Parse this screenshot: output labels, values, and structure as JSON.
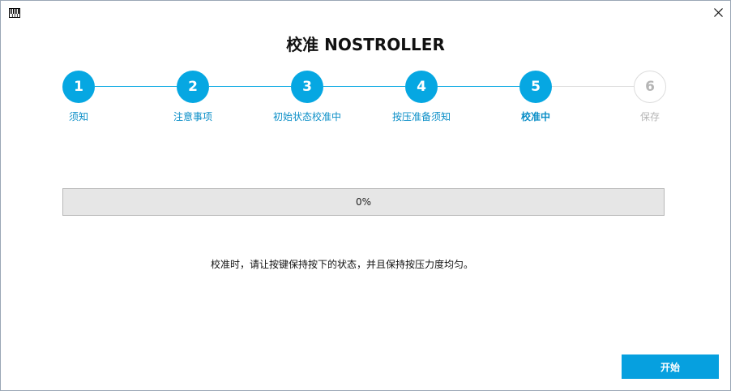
{
  "window": {
    "title": "校准 NOSTROLLER",
    "app_icon": "piano-keys-icon",
    "close_icon": "close-icon"
  },
  "colors": {
    "accent": "#06a7e2",
    "label_active": "#0a8ec7",
    "inactive": "#b5b5b5",
    "line_inactive": "#dcdcdc"
  },
  "stepper": {
    "current": 5,
    "steps": [
      {
        "number": "1",
        "label": "须知"
      },
      {
        "number": "2",
        "label": "注意事项"
      },
      {
        "number": "3",
        "label": "初始状态校准中"
      },
      {
        "number": "4",
        "label": "按压准备须知"
      },
      {
        "number": "5",
        "label": "校准中"
      },
      {
        "number": "6",
        "label": "保存"
      }
    ]
  },
  "progress": {
    "text": "0%",
    "value": 0
  },
  "instruction": "校准时，请让按键保持按下的状态，并且保持按压力度均匀。",
  "buttons": {
    "start": "开始"
  }
}
